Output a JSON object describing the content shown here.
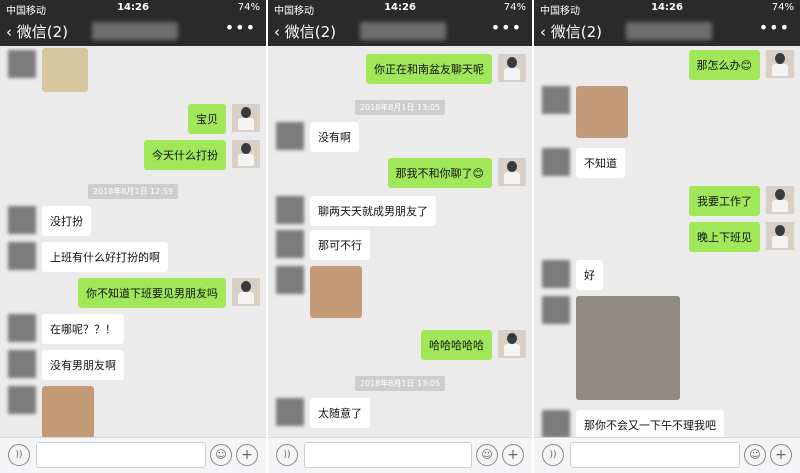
{
  "status": {
    "carrier": "中国移动",
    "time": "14:26",
    "battery": "74%"
  },
  "nav": {
    "back_label": "微信(2)",
    "more_icon": "•••"
  },
  "panels": [
    {
      "timestamp": "2018年8月1日 12:59",
      "messages": {
        "m1": "宝贝",
        "m2": "今天什么打扮",
        "m3": "没打扮",
        "m4": "上班有什么好打扮的啊",
        "m5": "你不知道下班要见男朋友吗",
        "m6": "在哪呢？？！",
        "m7": "没有男朋友啊"
      }
    },
    {
      "timestamps": [
        "2018年8月1日 13:05",
        "2018年8月1日 13:05"
      ],
      "messages": {
        "m1": "你正在和南盆友聊天呢",
        "m2": "没有啊",
        "m3": "那我不和你聊了😊",
        "m4": "聊两天天就成男朋友了",
        "m5": "那可不行",
        "m6": "哈哈哈哈哈",
        "m7": "太随意了"
      }
    },
    {
      "messages": {
        "m1": "那怎么办😊",
        "m2": "不知道",
        "m3": "我要工作了",
        "m4": "晚上下班见",
        "m5": "好",
        "m6": "那你不会又一下午不理我吧"
      }
    }
  ],
  "input": {
    "voice_icon": "))",
    "emoji_icon": "☺",
    "plus_icon": "+"
  }
}
